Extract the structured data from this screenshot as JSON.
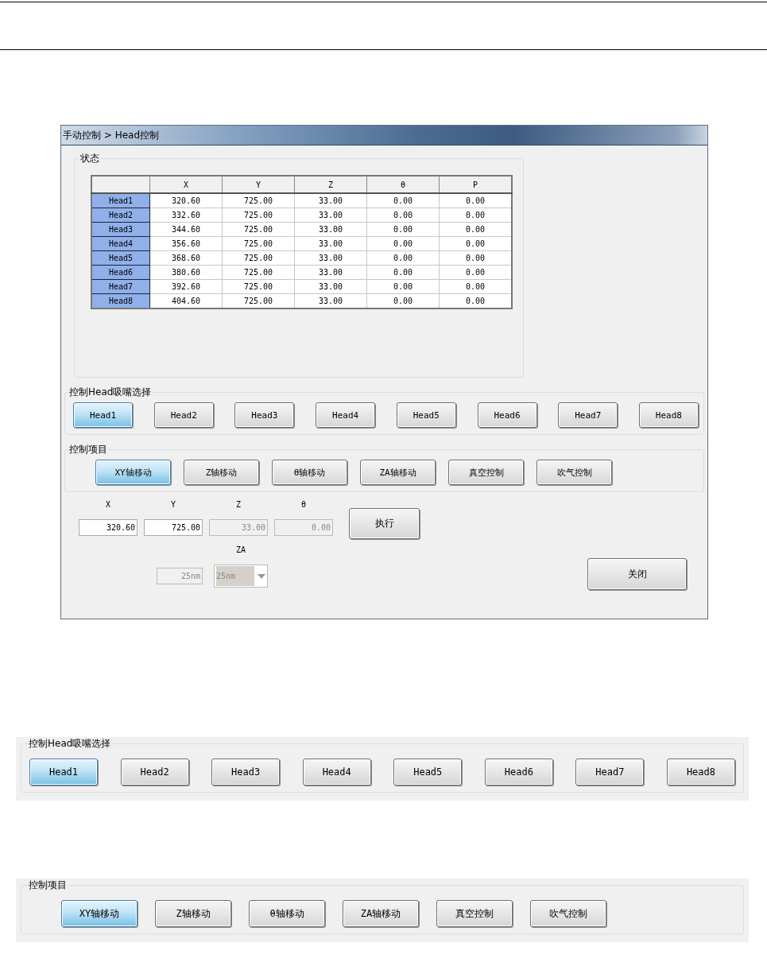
{
  "window": {
    "title": "手动控制 > Head控制"
  },
  "status_group": {
    "title": "状态",
    "columns": [
      "X",
      "Y",
      "Z",
      "θ",
      "P"
    ],
    "rows": [
      {
        "head": "Head1",
        "values": [
          "320.60",
          "725.00",
          "33.00",
          "0.00",
          "0.00"
        ]
      },
      {
        "head": "Head2",
        "values": [
          "332.60",
          "725.00",
          "33.00",
          "0.00",
          "0.00"
        ]
      },
      {
        "head": "Head3",
        "values": [
          "344.60",
          "725.00",
          "33.00",
          "0.00",
          "0.00"
        ]
      },
      {
        "head": "Head4",
        "values": [
          "356.60",
          "725.00",
          "33.00",
          "0.00",
          "0.00"
        ]
      },
      {
        "head": "Head5",
        "values": [
          "368.60",
          "725.00",
          "33.00",
          "0.00",
          "0.00"
        ]
      },
      {
        "head": "Head6",
        "values": [
          "380.60",
          "725.00",
          "33.00",
          "0.00",
          "0.00"
        ]
      },
      {
        "head": "Head7",
        "values": [
          "392.60",
          "725.00",
          "33.00",
          "0.00",
          "0.00"
        ]
      },
      {
        "head": "Head8",
        "values": [
          "404.60",
          "725.00",
          "33.00",
          "0.00",
          "0.00"
        ]
      }
    ]
  },
  "head_select": {
    "title": "控制Head吸嘴选择",
    "buttons": [
      {
        "label": "Head1",
        "selected": true
      },
      {
        "label": "Head2",
        "selected": false
      },
      {
        "label": "Head3",
        "selected": false
      },
      {
        "label": "Head4",
        "selected": false
      },
      {
        "label": "Head5",
        "selected": false
      },
      {
        "label": "Head6",
        "selected": false
      },
      {
        "label": "Head7",
        "selected": false
      },
      {
        "label": "Head8",
        "selected": false
      }
    ]
  },
  "control_items": {
    "title": "控制项目",
    "buttons": [
      {
        "label": "XY轴移动",
        "selected": true
      },
      {
        "label": "Z轴移动",
        "selected": false
      },
      {
        "label": "θ轴移动",
        "selected": false
      },
      {
        "label": "ZA轴移动",
        "selected": false
      },
      {
        "label": "真空控制",
        "selected": false
      },
      {
        "label": "吹气控制",
        "selected": false
      }
    ]
  },
  "inputs": [
    {
      "label": "X",
      "value": "320.60",
      "disabled": false
    },
    {
      "label": "Y",
      "value": "725.00",
      "disabled": false
    },
    {
      "label": "Z",
      "value": "33.00",
      "disabled": true
    },
    {
      "label": "θ",
      "value": "0.00",
      "disabled": true
    }
  ],
  "execute_button": "执行",
  "za": {
    "label": "ZA",
    "field_value": "25nm",
    "dropdown_value": "25nm"
  },
  "close_button": "关闭",
  "zoom_head_select": {
    "title": "控制Head吸嘴选择",
    "buttons": [
      {
        "label": "Head1",
        "selected": true
      },
      {
        "label": "Head2",
        "selected": false
      },
      {
        "label": "Head3",
        "selected": false
      },
      {
        "label": "Head4",
        "selected": false
      },
      {
        "label": "Head5",
        "selected": false
      },
      {
        "label": "Head6",
        "selected": false
      },
      {
        "label": "Head7",
        "selected": false
      },
      {
        "label": "Head8",
        "selected": false
      }
    ]
  },
  "zoom_control_items": {
    "title": "控制项目",
    "buttons": [
      {
        "label": "XY轴移动",
        "selected": true
      },
      {
        "label": "Z轴移动",
        "selected": false
      },
      {
        "label": "θ轴移动",
        "selected": false
      },
      {
        "label": "ZA轴移动",
        "selected": false
      },
      {
        "label": "真空控制",
        "selected": false
      },
      {
        "label": "吹气控制",
        "selected": false
      }
    ]
  }
}
